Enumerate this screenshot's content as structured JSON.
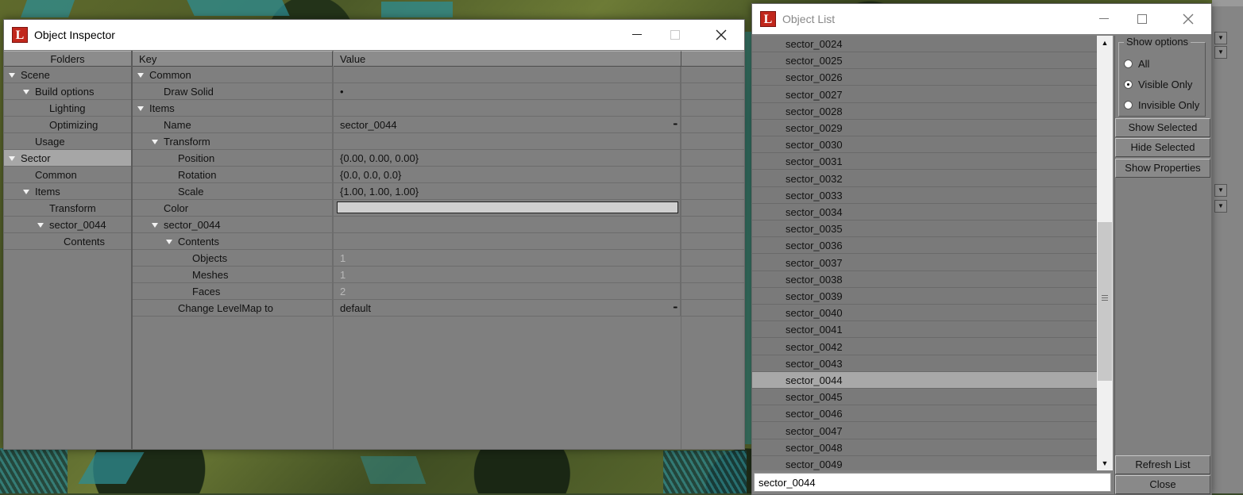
{
  "inspector": {
    "title": "Object Inspector",
    "icon": "L",
    "folders_header": "Folders",
    "key_header": "Key",
    "value_header": "Value",
    "folders": [
      {
        "label": "Scene",
        "level": 0,
        "expanded": true
      },
      {
        "label": "Build options",
        "level": 1,
        "expanded": true
      },
      {
        "label": "Lighting",
        "level": 2
      },
      {
        "label": "Optimizing",
        "level": 2
      },
      {
        "label": "Usage",
        "level": 1
      },
      {
        "label": "Sector",
        "level": 0,
        "expanded": true,
        "selected": true
      },
      {
        "label": "Common",
        "level": 1
      },
      {
        "label": "Items",
        "level": 1,
        "expanded": true
      },
      {
        "label": "Transform",
        "level": 2
      },
      {
        "label": "sector_0044",
        "level": 2,
        "expanded": true
      },
      {
        "label": "Contents",
        "level": 3
      }
    ],
    "properties": [
      {
        "key": "Common",
        "level": 0,
        "expanded": true,
        "value": ""
      },
      {
        "key": "Draw Solid",
        "level": 1,
        "value": "•"
      },
      {
        "key": "Items",
        "level": 0,
        "expanded": true,
        "value": ""
      },
      {
        "key": "Name",
        "level": 1,
        "value": "sector_0044",
        "ellipsis": true
      },
      {
        "key": "Transform",
        "level": 1,
        "expanded": true,
        "value": ""
      },
      {
        "key": "Position",
        "level": 2,
        "value": "{0.00, 0.00, 0.00}"
      },
      {
        "key": "Rotation",
        "level": 2,
        "value": "{0.0, 0.0, 0.0}"
      },
      {
        "key": "Scale",
        "level": 2,
        "value": "{1.00, 1.00, 1.00}"
      },
      {
        "key": "Color",
        "level": 1,
        "value": "",
        "color": "#cfcfcf"
      },
      {
        "key": "sector_0044",
        "level": 1,
        "expanded": true,
        "value": ""
      },
      {
        "key": "Contents",
        "level": 2,
        "expanded": true,
        "value": ""
      },
      {
        "key": "Objects",
        "level": 3,
        "value": "1",
        "muted": true
      },
      {
        "key": "Meshes",
        "level": 3,
        "value": "1",
        "muted": true
      },
      {
        "key": "Faces",
        "level": 3,
        "value": "2",
        "muted": true
      },
      {
        "key": "Change LevelMap to",
        "level": 2,
        "value": "default",
        "ellipsis": true
      }
    ]
  },
  "object_list": {
    "title": "Object List",
    "icon": "L",
    "items": [
      "sector_0024",
      "sector_0025",
      "sector_0026",
      "sector_0027",
      "sector_0028",
      "sector_0029",
      "sector_0030",
      "sector_0031",
      "sector_0032",
      "sector_0033",
      "sector_0034",
      "sector_0035",
      "sector_0036",
      "sector_0037",
      "sector_0038",
      "sector_0039",
      "sector_0040",
      "sector_0041",
      "sector_0042",
      "sector_0043",
      "sector_0044",
      "sector_0045",
      "sector_0046",
      "sector_0047",
      "sector_0048",
      "sector_0049"
    ],
    "selected": "sector_0044",
    "find_value": "sector_0044",
    "show_options": {
      "legend": "Show options",
      "options": [
        {
          "label": "All",
          "checked": false
        },
        {
          "label": "Visible Only",
          "checked": true
        },
        {
          "label": "Invisible Only",
          "checked": false
        }
      ]
    },
    "buttons": {
      "show_selected": "Show Selected",
      "hide_selected": "Hide Selected",
      "show_properties": "Show Properties",
      "refresh_list": "Refresh List",
      "close": "Close"
    }
  },
  "icons": {
    "app": "app-logo-icon",
    "minimize": "minimize-icon",
    "maximize": "maximize-icon",
    "close": "close-icon",
    "expand": "triangle-down-icon",
    "scroll_up": "scroll-up-icon",
    "scroll_down": "scroll-down-icon"
  },
  "colors": {
    "panel": "#808080",
    "selected_row": "#a8a8a8",
    "app_icon": "#c1271c",
    "titlebar": "#ffffff"
  }
}
